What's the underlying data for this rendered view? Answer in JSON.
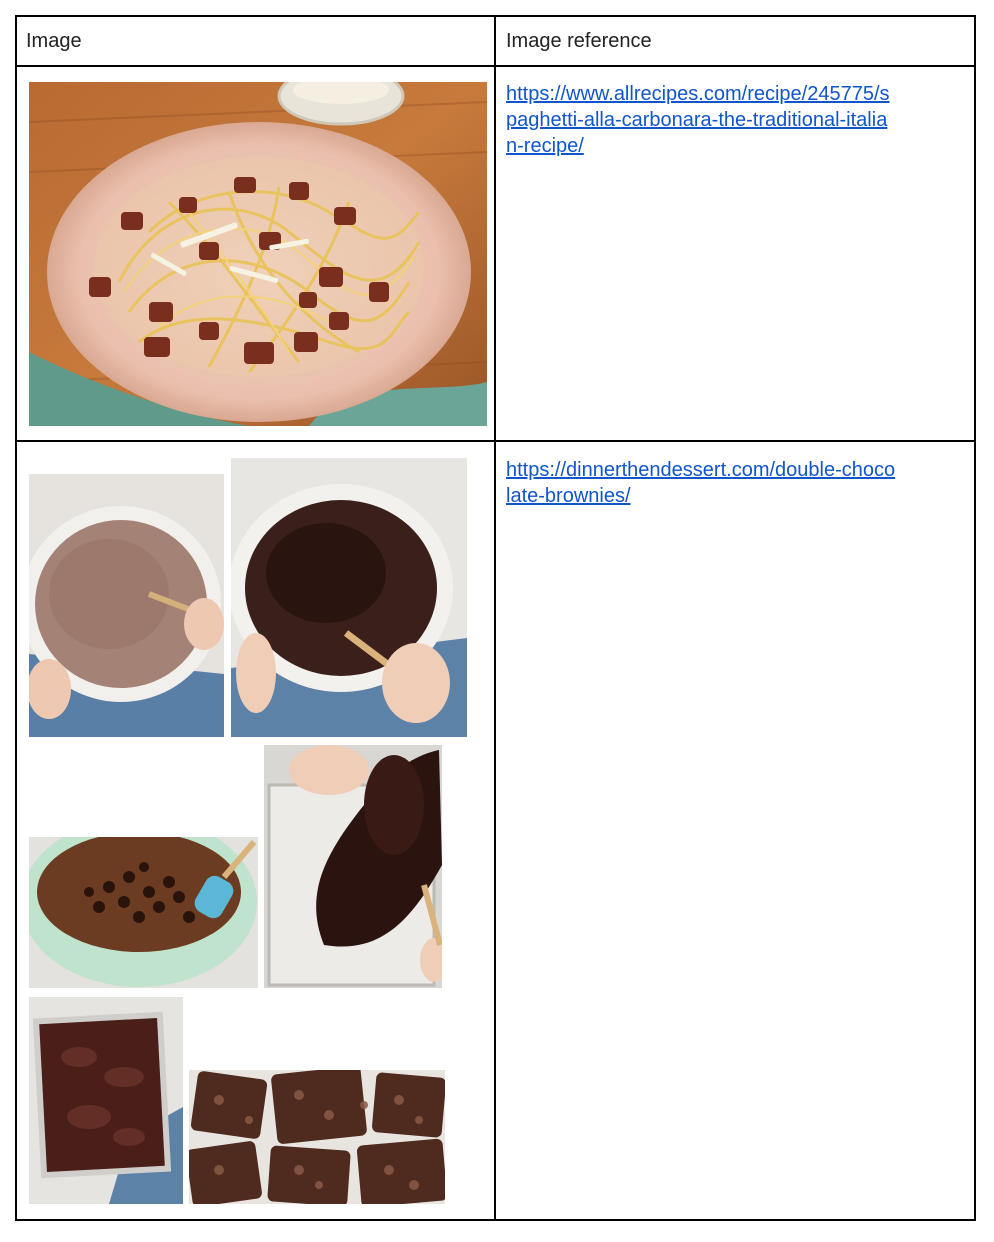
{
  "table": {
    "headers": [
      "Image",
      "Image reference"
    ],
    "rows": [
      {
        "image_description_icon": "carbonara-photo",
        "reference": "https://www.allrecipes.com/recipe/245775/spaghetti-alla-carbonara-the-traditional-italian-recipe/",
        "reference_lines": [
          "https://www.allrecipes.com/recipe/245775/s",
          "paghetti-alla-carbonara-the-traditional-italia",
          "n-recipe/"
        ]
      },
      {
        "image_description_icon": "brownie-steps-photos",
        "reference": "https://dinnerthendessert.com/double-chocolate-brownies/",
        "reference_lines": [
          "https://dinnerthendessert.com/double-choco",
          "late-brownies/"
        ]
      }
    ]
  },
  "colors": {
    "link": "#1155cc",
    "border": "#000000"
  }
}
